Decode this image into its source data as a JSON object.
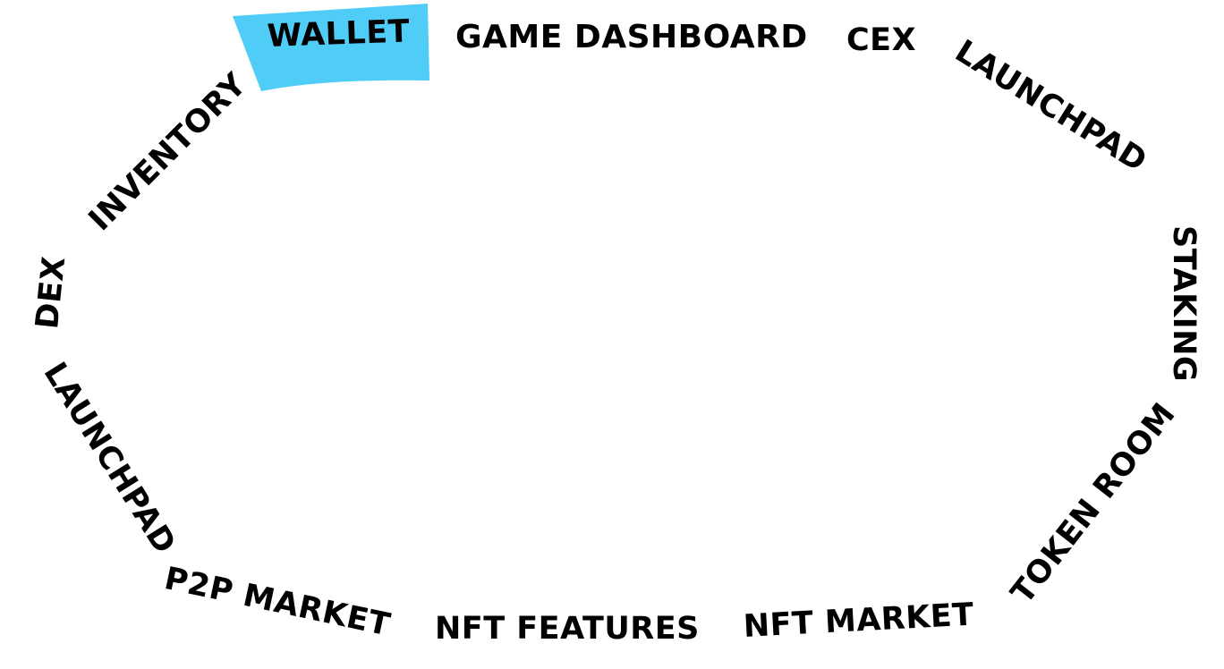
{
  "menu": {
    "active": "WALLET",
    "highlight_color": "#4fcdf7",
    "text_color": "#000000",
    "background": "#ffffff",
    "items": [
      {
        "id": "wallet",
        "label": "WALLET"
      },
      {
        "id": "game-dashboard",
        "label": "GAME DASHBOARD"
      },
      {
        "id": "cex",
        "label": "CEX"
      },
      {
        "id": "launchpad-top",
        "label": "LAUNCHPAD"
      },
      {
        "id": "staking",
        "label": "STAKING"
      },
      {
        "id": "token-room",
        "label": "TOKEN ROOM"
      },
      {
        "id": "nft-market",
        "label": "NFT MARKET"
      },
      {
        "id": "nft-features",
        "label": "NFT FEATURES"
      },
      {
        "id": "p2p-market",
        "label": "P2P MARKET"
      },
      {
        "id": "launchpad-left",
        "label": "LAUNCHPAD"
      },
      {
        "id": "dex",
        "label": "DEX"
      },
      {
        "id": "inventory",
        "label": "INVENTORY"
      }
    ]
  }
}
